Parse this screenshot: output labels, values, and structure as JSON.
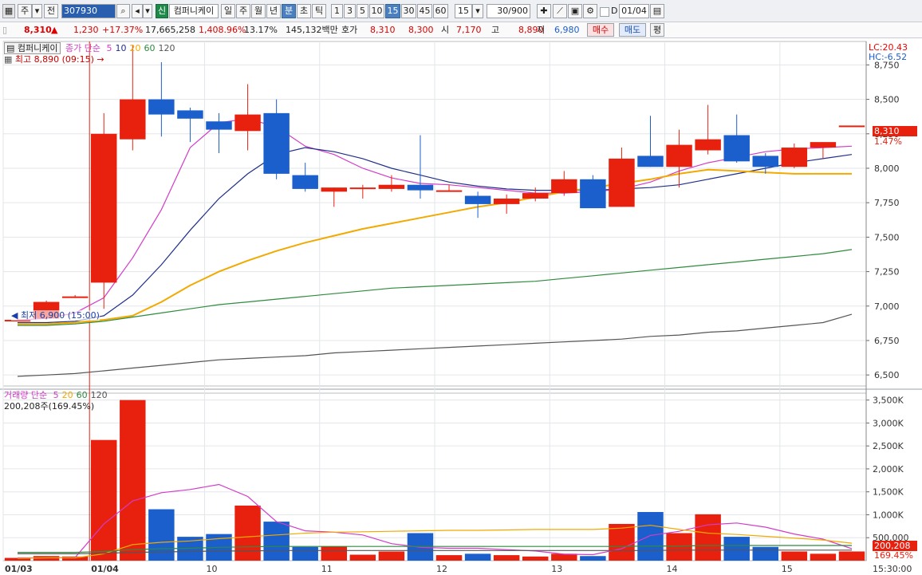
{
  "toolbar": {
    "type_select": "주",
    "prev_button": "전",
    "code_input": "307930",
    "new_badge": "신",
    "stock_name": "컴퍼니케이",
    "period_tabs": [
      "일",
      "주",
      "월",
      "년",
      "분",
      "초",
      "틱"
    ],
    "selected_period": "분",
    "interval_buttons": [
      "1",
      "3",
      "5",
      "10",
      "15",
      "30",
      "45",
      "60"
    ],
    "selected_interval": "15",
    "interval_input": "15",
    "count_value": "30",
    "count_total": "/900",
    "checkbox_label": "D",
    "date_value": "01/04"
  },
  "info": {
    "price": "8,310",
    "change": "1,230",
    "change_rate": "+17.37%",
    "volume": "17,665,258",
    "volume_rate": "1,408.96%",
    "turnover": "13.17%",
    "amount": "145,132백만",
    "quote_label": "호가",
    "ask": "8,310",
    "bid": "8,300",
    "open_label": "시",
    "open": "7,170",
    "high_label": "고",
    "high": "8,890",
    "low_label": "저",
    "low": "6,980",
    "buy_button": "매수",
    "sell_button": "매도",
    "eval_button": "평"
  },
  "legend": {
    "stock_tag": "컴퍼니케이",
    "price_ma_label": "종가 단순",
    "ma_periods": [
      "5",
      "10",
      "20",
      "60",
      "120"
    ],
    "high_marker": "최고 8,890 (09:15)",
    "low_marker": "최저 6,900 (15:00)",
    "lc": "LC:20.43",
    "hc": "HC:-6.52",
    "volume_label": "거래량",
    "volume_ma_label": "단순",
    "volume_ma_periods": [
      "5",
      "20",
      "60",
      "120"
    ],
    "volume_value": "200,208주(169.45%)",
    "last_price_tag": "8,310",
    "last_price_pct": "1.47%",
    "last_volume_tag": "200,208",
    "last_volume_pct": "169.45%"
  },
  "colors": {
    "up": "#e8210f",
    "down": "#1b5fcc",
    "ma5": "#d23cc8",
    "ma10": "#1f2f8a",
    "ma20": "#f2a900",
    "ma60": "#2e8b3e",
    "ma120": "#555555"
  },
  "chart_data": {
    "type": "candlestick",
    "price_axis_ticks": [
      "8,750",
      "8,500",
      "8,250",
      "8,000",
      "7,750",
      "7,500",
      "7,250",
      "7,000",
      "6,750",
      "6,500"
    ],
    "price_range": [
      6420,
      8920
    ],
    "volume_axis_ticks": [
      "3,500K",
      "3,000K",
      "2,500K",
      "2,000K",
      "1,500K",
      "1,000K",
      "500,000"
    ],
    "volume_range": [
      0,
      3650000
    ],
    "date_labels": [
      "01/03",
      "01/04",
      "10",
      "11",
      "12",
      "13",
      "14",
      "15",
      "15:30:00"
    ],
    "candles": [
      {
        "o": 6900,
        "h": 6920,
        "l": 6890,
        "c": 6900
      },
      {
        "o": 6910,
        "h": 7040,
        "l": 6900,
        "c": 7030
      },
      {
        "o": 7070,
        "h": 7080,
        "l": 7060,
        "c": 7070
      },
      {
        "o": 7170,
        "h": 8400,
        "l": 6980,
        "c": 8250
      },
      {
        "o": 8210,
        "h": 8890,
        "l": 8130,
        "c": 8500
      },
      {
        "o": 8500,
        "h": 8770,
        "l": 8230,
        "c": 8390
      },
      {
        "o": 8420,
        "h": 8440,
        "l": 8190,
        "c": 8360
      },
      {
        "o": 8340,
        "h": 8400,
        "l": 8110,
        "c": 8280
      },
      {
        "o": 8270,
        "h": 8610,
        "l": 8130,
        "c": 8390
      },
      {
        "o": 8400,
        "h": 8500,
        "l": 7920,
        "c": 7960
      },
      {
        "o": 7950,
        "h": 8040,
        "l": 7830,
        "c": 7850
      },
      {
        "o": 7830,
        "h": 7860,
        "l": 7720,
        "c": 7860
      },
      {
        "o": 7850,
        "h": 7880,
        "l": 7780,
        "c": 7860
      },
      {
        "o": 7850,
        "h": 7950,
        "l": 7830,
        "c": 7880
      },
      {
        "o": 7880,
        "h": 8240,
        "l": 7780,
        "c": 7840
      },
      {
        "o": 7840,
        "h": 7880,
        "l": 7830,
        "c": 7840
      },
      {
        "o": 7800,
        "h": 7830,
        "l": 7640,
        "c": 7740
      },
      {
        "o": 7740,
        "h": 7810,
        "l": 7670,
        "c": 7780
      },
      {
        "o": 7780,
        "h": 7860,
        "l": 7760,
        "c": 7820
      },
      {
        "o": 7820,
        "h": 7980,
        "l": 7800,
        "c": 7920
      },
      {
        "o": 7920,
        "h": 7950,
        "l": 7720,
        "c": 7710
      },
      {
        "o": 7720,
        "h": 8150,
        "l": 7720,
        "c": 8070
      },
      {
        "o": 8090,
        "h": 8380,
        "l": 8010,
        "c": 8010
      },
      {
        "o": 8010,
        "h": 8280,
        "l": 7860,
        "c": 8170
      },
      {
        "o": 8130,
        "h": 8460,
        "l": 8100,
        "c": 8210
      },
      {
        "o": 8240,
        "h": 8390,
        "l": 8040,
        "c": 8050
      },
      {
        "o": 8090,
        "h": 8110,
        "l": 7960,
        "c": 8010
      },
      {
        "o": 8010,
        "h": 8180,
        "l": 8000,
        "c": 8150
      },
      {
        "o": 8150,
        "h": 8190,
        "l": 8070,
        "c": 8190
      },
      {
        "o": 8310,
        "h": 8310,
        "l": 8310,
        "c": 8310
      }
    ],
    "volumes": [
      60000,
      100000,
      90000,
      2630000,
      3500000,
      1120000,
      520000,
      580000,
      1200000,
      850000,
      300000,
      310000,
      130000,
      200000,
      600000,
      120000,
      150000,
      120000,
      90000,
      150000,
      100000,
      800000,
      1060000,
      600000,
      1010000,
      520000,
      300000,
      200000,
      150000,
      200208
    ],
    "ma": {
      "5": [
        6900,
        6910,
        6950,
        7060,
        7350,
        7700,
        8150,
        8330,
        8360,
        8300,
        8160,
        8100,
        8000,
        7930,
        7890,
        7880,
        7860,
        7840,
        7820,
        7820,
        7830,
        7850,
        7900,
        7980,
        8040,
        8080,
        8120,
        8140,
        8150,
        8160
      ],
      "10": [
        6880,
        6880,
        6890,
        6930,
        7080,
        7300,
        7550,
        7780,
        7960,
        8100,
        8150,
        8120,
        8070,
        8000,
        7950,
        7900,
        7870,
        7850,
        7840,
        7840,
        7840,
        7850,
        7860,
        7880,
        7920,
        7960,
        8000,
        8040,
        8070,
        8100
      ],
      "20": [
        6870,
        6870,
        6880,
        6900,
        6930,
        7030,
        7150,
        7250,
        7330,
        7400,
        7460,
        7510,
        7560,
        7600,
        7640,
        7680,
        7720,
        7750,
        7790,
        7830,
        7860,
        7890,
        7920,
        7960,
        7990,
        7980,
        7970,
        7960,
        7960,
        7960
      ],
      "60": [
        6860,
        6860,
        6870,
        6890,
        6920,
        6950,
        6980,
        7010,
        7030,
        7050,
        7070,
        7090,
        7110,
        7130,
        7140,
        7150,
        7160,
        7170,
        7180,
        7200,
        7220,
        7240,
        7260,
        7280,
        7300,
        7320,
        7340,
        7360,
        7380,
        7410
      ],
      "120": [
        6490,
        6500,
        6510,
        6530,
        6550,
        6570,
        6590,
        6610,
        6620,
        6630,
        6640,
        6660,
        6670,
        6680,
        6690,
        6700,
        6710,
        6720,
        6730,
        6740,
        6750,
        6760,
        6780,
        6790,
        6810,
        6820,
        6840,
        6860,
        6880,
        6940
      ]
    },
    "vma": {
      "5": [
        60000,
        60000,
        70000,
        800000,
        1300000,
        1480000,
        1550000,
        1660000,
        1400000,
        850000,
        650000,
        620000,
        560000,
        370000,
        290000,
        270000,
        270000,
        240000,
        210000,
        140000,
        130000,
        260000,
        550000,
        640000,
        780000,
        820000,
        730000,
        580000,
        470000,
        260000
      ],
      "20": [
        50000,
        60000,
        60000,
        150000,
        350000,
        400000,
        430000,
        480000,
        520000,
        560000,
        600000,
        620000,
        630000,
        640000,
        650000,
        660000,
        660000,
        670000,
        680000,
        680000,
        680000,
        710000,
        770000,
        680000,
        600000,
        570000,
        530000,
        490000,
        450000,
        380000
      ],
      "60": [
        180000,
        180000,
        180000,
        200000,
        240000,
        260000,
        270000,
        290000,
        300000,
        310000,
        310000,
        310000,
        310000,
        310000,
        310000,
        310000,
        310000,
        310000,
        310000,
        310000,
        310000,
        310000,
        320000,
        320000,
        330000,
        330000,
        330000,
        330000,
        330000,
        330000
      ],
      "120": [
        150000,
        150000,
        150000,
        160000,
        180000,
        190000,
        200000,
        210000,
        210000,
        220000,
        220000,
        220000,
        220000,
        220000,
        220000,
        220000,
        220000,
        220000,
        220000,
        220000,
        220000,
        220000,
        220000,
        230000,
        230000,
        230000,
        230000,
        230000,
        230000,
        230000
      ]
    }
  }
}
